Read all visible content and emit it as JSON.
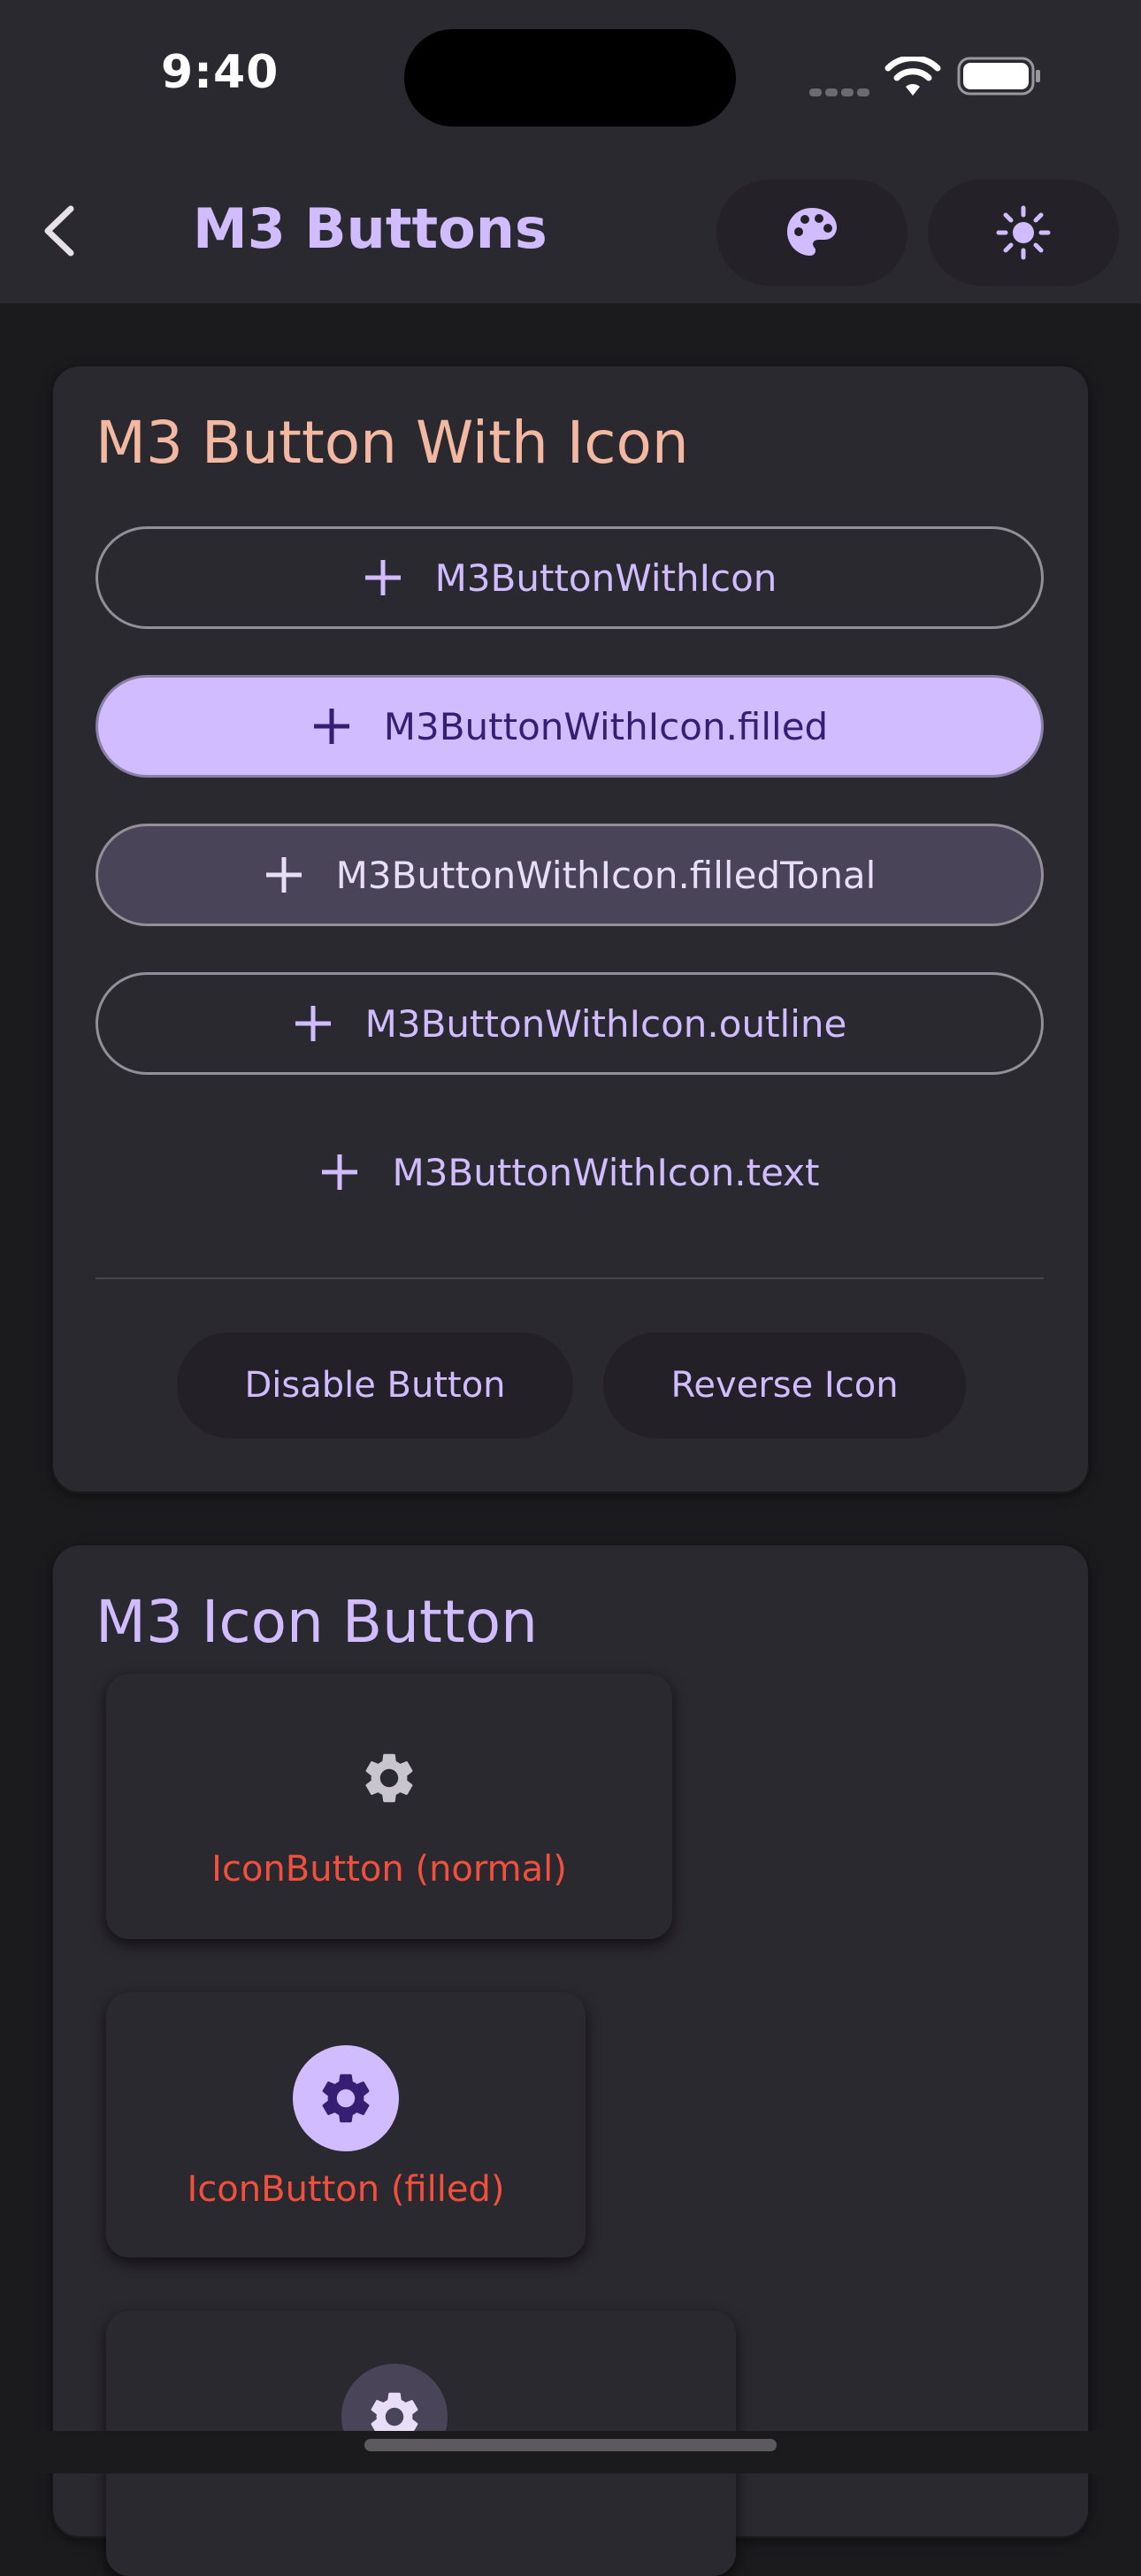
{
  "status_bar": {
    "time": "9:40"
  },
  "app_bar": {
    "title": "M3 Buttons",
    "actions": [
      {
        "icon": "palette-icon"
      },
      {
        "icon": "brightness-icon"
      }
    ]
  },
  "colors": {
    "primary": "#d0bcff",
    "on_primary": "#381e72",
    "surface": "#2b2930",
    "background": "#1b1b1e",
    "tonal": "#4a4458",
    "error_label": "#f2503d",
    "section_title_1": "#f2b8a2"
  },
  "section_button_with_icon": {
    "title": "M3 Button With Icon",
    "buttons": [
      {
        "label": "M3ButtonWithIcon",
        "variant": "default",
        "icon": "plus-icon"
      },
      {
        "label": "M3ButtonWithIcon.filled",
        "variant": "filled",
        "icon": "plus-icon"
      },
      {
        "label": "M3ButtonWithIcon.filledTonal",
        "variant": "filledTonal",
        "icon": "plus-icon"
      },
      {
        "label": "M3ButtonWithIcon.outline",
        "variant": "outline",
        "icon": "plus-icon"
      },
      {
        "label": "M3ButtonWithIcon.text",
        "variant": "text",
        "icon": "plus-icon"
      }
    ],
    "controls": {
      "disable_label": "Disable Button",
      "reverse_label": "Reverse Icon"
    }
  },
  "section_icon_button": {
    "title": "M3 Icon Button",
    "items": [
      {
        "label": "IconButton (normal)",
        "icon": "settings-icon"
      },
      {
        "label": "IconButton (filled)",
        "icon": "settings-icon"
      },
      {
        "label": "",
        "icon": "settings-icon"
      }
    ]
  }
}
